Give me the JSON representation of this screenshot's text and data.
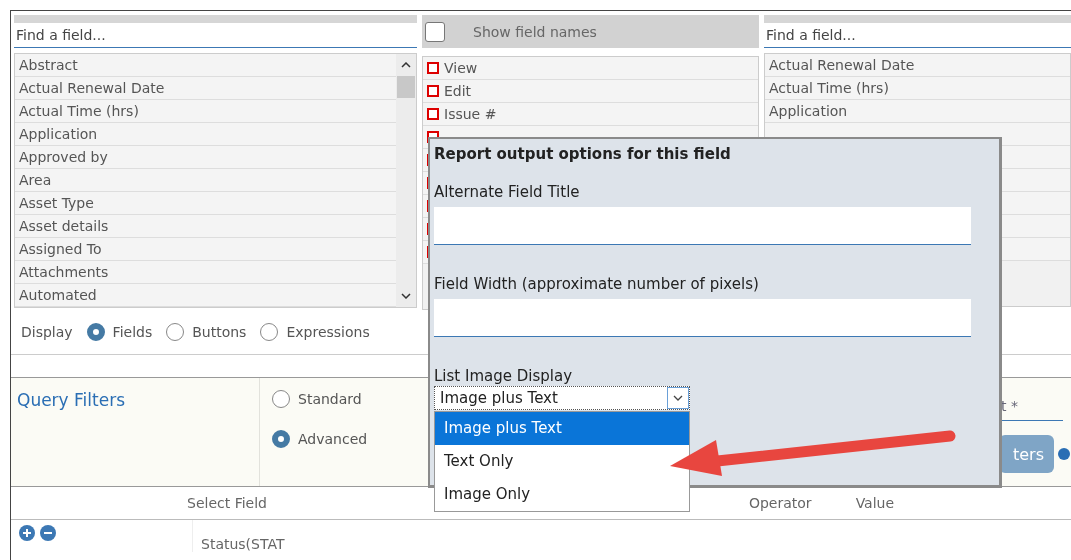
{
  "left_panel": {
    "search": {
      "placeholder": "Find a field..."
    },
    "items": [
      "Abstract",
      "Actual Renewal Date",
      "Actual Time (hrs)",
      "Application",
      "Approved by",
      "Area",
      "Asset Type",
      "Asset details",
      "Assigned To",
      "Attachments",
      "Automated"
    ]
  },
  "show_field_names": {
    "label": "Show field names",
    "checked": false
  },
  "middle_list": [
    "View",
    "Edit",
    "Issue #"
  ],
  "right_panel": {
    "search": {
      "placeholder": "Find a field..."
    },
    "items": [
      "Actual Renewal Date",
      "Actual Time (hrs)",
      "Application"
    ]
  },
  "display": {
    "label": "Display",
    "options": [
      {
        "label": "Fields",
        "selected": true
      },
      {
        "label": "Buttons",
        "selected": false
      },
      {
        "label": "Expressions",
        "selected": false
      }
    ]
  },
  "query_filters": {
    "title": "Query Filters",
    "modes": [
      {
        "label": "Standard",
        "selected": false
      },
      {
        "label": "Advanced",
        "selected": true
      }
    ],
    "field_placeholder": "t *",
    "button": "ters"
  },
  "filter_table": {
    "columns": [
      "Select Field",
      "Operator",
      "Value"
    ],
    "rows": [
      {
        "field": "Status(STAT"
      }
    ]
  },
  "popup": {
    "title": "Report output options for this field",
    "fields": [
      {
        "label": "Alternate Field Title"
      },
      {
        "label": "Field Width (approximate number of pixels)"
      }
    ],
    "select": {
      "label": "List Image Display",
      "value": "Image plus Text",
      "options": [
        {
          "label": "Image plus Text",
          "selected": true
        },
        {
          "label": "Text Only",
          "selected": false
        },
        {
          "label": "Image Only",
          "selected": false
        }
      ]
    }
  }
}
